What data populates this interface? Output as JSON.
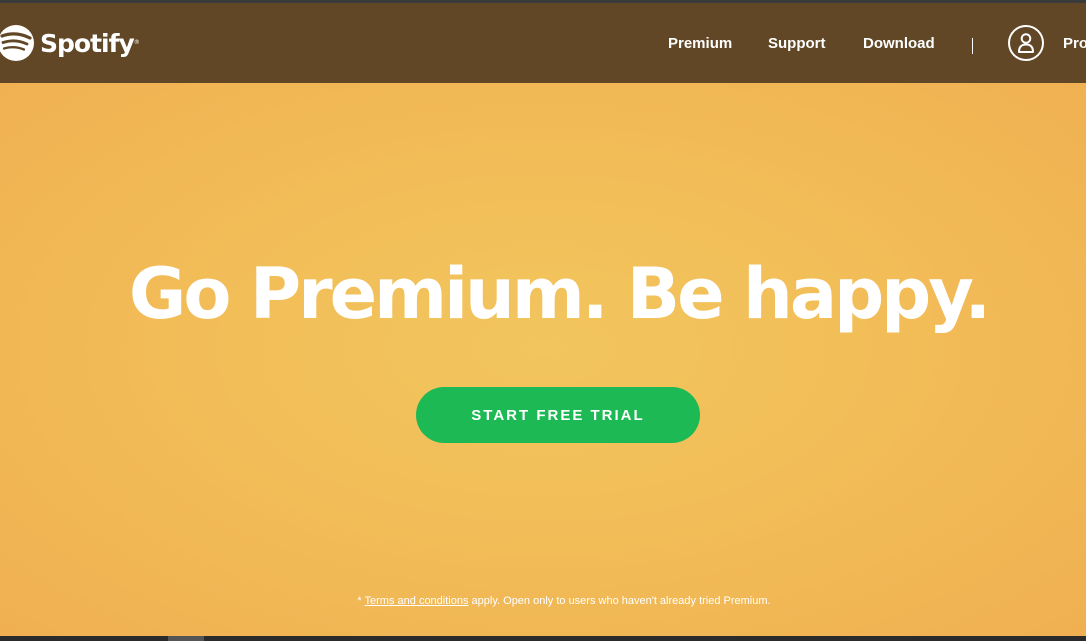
{
  "brand": {
    "name": "Spotify",
    "tm": "®",
    "logo_icon": "spotify-logo-icon"
  },
  "nav": {
    "items": [
      {
        "label": "Premium"
      },
      {
        "label": "Support"
      },
      {
        "label": "Download"
      }
    ],
    "profile_label": "Profile",
    "profile_icon": "user-icon"
  },
  "hero": {
    "headline": "Go Premium. Be happy.",
    "cta_label": "START FREE TRIAL",
    "disclaimer_prefix": "* ",
    "disclaimer_link": "Terms and conditions",
    "disclaimer_suffix": " apply. Open only to users who haven't already tried Premium."
  },
  "colors": {
    "header_bg": "#614726",
    "hero_bg": "#f2be58",
    "cta_bg": "#1db954",
    "text": "#ffffff"
  }
}
